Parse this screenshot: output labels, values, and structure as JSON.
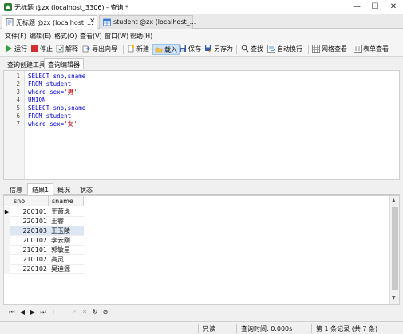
{
  "window": {
    "title": "无标题 @zx (localhost_3306) - 查询 *",
    "controls": [
      "—",
      "☐",
      "✕"
    ]
  },
  "doc_tabs": [
    {
      "label": "无标题 @zx (localhost_...",
      "close": "✕",
      "active": true,
      "icon": "query-icon"
    },
    {
      "label": "student @zx (localhost_...",
      "close": "",
      "active": false,
      "icon": "table-icon"
    }
  ],
  "menu": [
    "文件(F)",
    "编辑(E)",
    "格式(O)",
    "查看(V)",
    "窗口(W)",
    "帮助(H)"
  ],
  "toolbar": {
    "run": "运行",
    "stop": "停止",
    "explain": "解释",
    "export": "导出向导",
    "new": "新建",
    "load": "载入",
    "save": "保存",
    "save_as": "另存为",
    "find": "查找",
    "word_wrap": "自动换行",
    "grid_view": "网格查看",
    "form_view": "表单查看"
  },
  "sub_tabs": [
    "查询创建工具",
    "查询编辑器"
  ],
  "editor": {
    "lines": [
      {
        "n": "1",
        "parts": [
          {
            "t": "SELECT",
            "c": "kw"
          },
          {
            "t": " sno,sname",
            "c": "kw"
          }
        ]
      },
      {
        "n": "2",
        "parts": [
          {
            "t": "FROM",
            "c": "kw"
          },
          {
            "t": " student",
            "c": "kw"
          }
        ]
      },
      {
        "n": "3",
        "parts": [
          {
            "t": "where",
            "c": "kw"
          },
          {
            "t": " sex=",
            "c": "kw"
          },
          {
            "t": "'男'",
            "c": "str"
          }
        ]
      },
      {
        "n": "4",
        "parts": [
          {
            "t": "UNION",
            "c": "kw"
          }
        ]
      },
      {
        "n": "5",
        "parts": [
          {
            "t": "SELECT",
            "c": "kw"
          },
          {
            "t": " sno,sname",
            "c": "kw"
          }
        ]
      },
      {
        "n": "6",
        "parts": [
          {
            "t": "FROM",
            "c": "kw"
          },
          {
            "t": " student",
            "c": "kw"
          }
        ]
      },
      {
        "n": "7",
        "parts": [
          {
            "t": "where",
            "c": "kw"
          },
          {
            "t": " sex=",
            "c": "kw"
          },
          {
            "t": "'女'",
            "c": "str"
          }
        ]
      }
    ]
  },
  "result_tabs": [
    "信息",
    "结果1",
    "概况",
    "状态"
  ],
  "grid": {
    "columns": [
      "sno",
      "sname"
    ],
    "rows": [
      [
        "200101",
        "王萧虎"
      ],
      [
        "220101",
        "王睿"
      ],
      [
        "220103",
        "王玉陵"
      ],
      [
        "200102",
        "李云刚"
      ],
      [
        "210101",
        "郭敏星"
      ],
      [
        "210102",
        "高灵"
      ],
      [
        "220102",
        "吴迪源"
      ]
    ],
    "selected_row": 2
  },
  "nav": [
    "⏮",
    "◀",
    "▶",
    "⏭",
    "+",
    "−",
    "✓",
    "✕",
    "↻",
    "⊘"
  ],
  "status": {
    "mode": "只读",
    "query_time": "查询时间: 0.000s",
    "record": "第 1 条记录 (共 7 条)"
  },
  "colors": {
    "keyword": "#0000d0",
    "string": "#c00000",
    "selected_row": "#dde7f4"
  }
}
